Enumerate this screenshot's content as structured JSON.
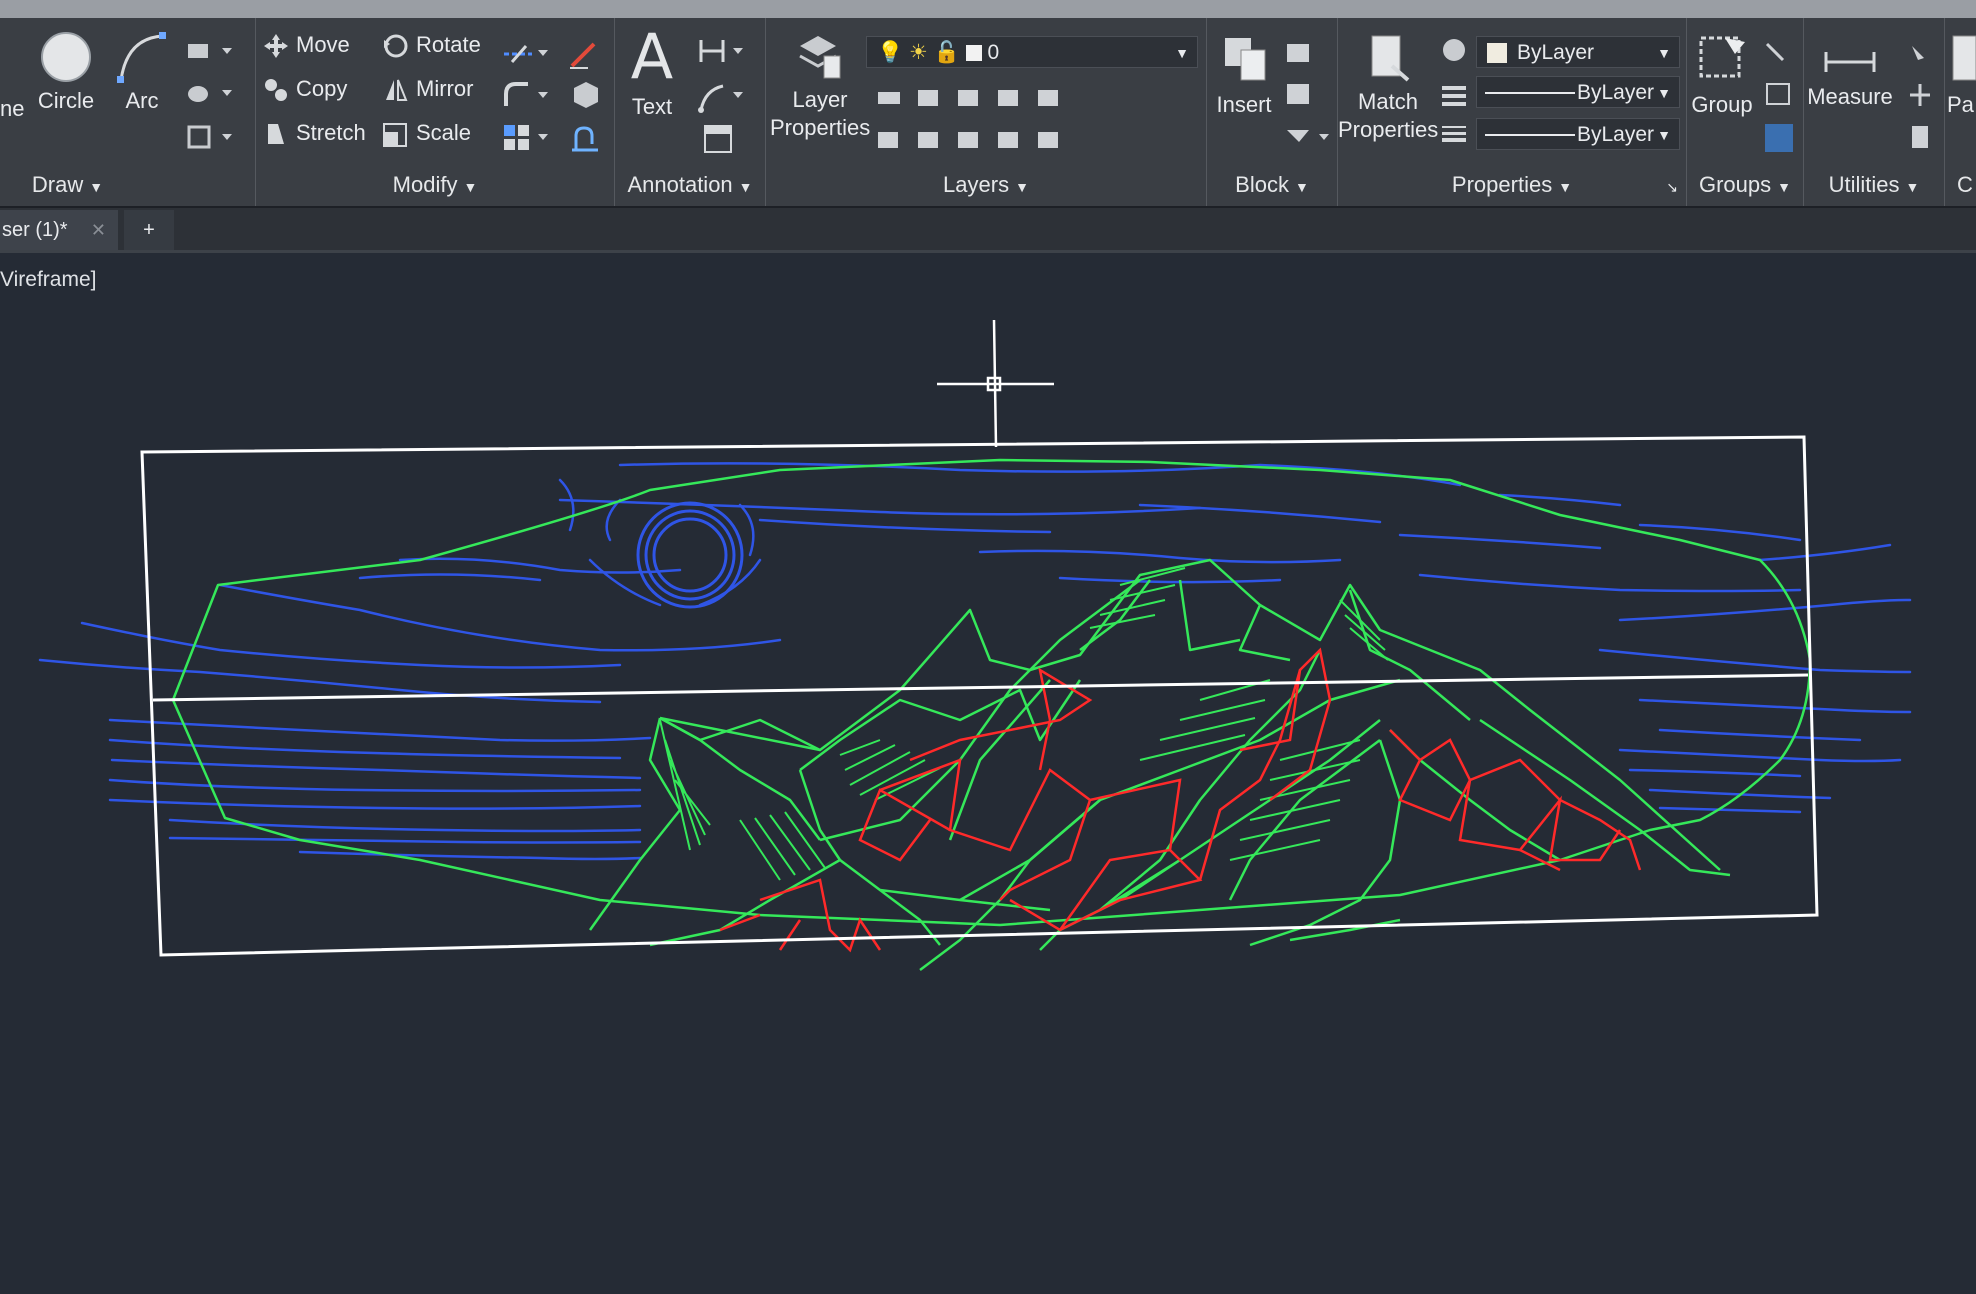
{
  "ribbon": {
    "draw": {
      "partial_label": "ne",
      "circle_label": "Circle",
      "arc_label": "Arc",
      "title": "Draw"
    },
    "modify": {
      "move": "Move",
      "rotate": "Rotate",
      "copy": "Copy",
      "mirror": "Mirror",
      "stretch": "Stretch",
      "scale": "Scale",
      "title": "Modify"
    },
    "annotation": {
      "text_label": "Text",
      "title": "Annotation"
    },
    "layers": {
      "layer_properties_line1": "Layer",
      "layer_properties_line2": "Properties",
      "current_layer": "0",
      "title": "Layers"
    },
    "block": {
      "insert_label": "Insert",
      "title": "Block"
    },
    "properties": {
      "match_line1": "Match",
      "match_line2": "Properties",
      "color_value": "ByLayer",
      "linetype_value": "ByLayer",
      "lineweight_value": "ByLayer",
      "title": "Properties"
    },
    "groups": {
      "group_label": "Group",
      "title": "Groups"
    },
    "utilities": {
      "measure_label": "Measure",
      "title": "Utilities"
    },
    "clipboard": {
      "partial_label": "Pa",
      "partial_title": "C"
    }
  },
  "tabs": {
    "document_tab": "ser (1)*",
    "close_glyph": "✕",
    "new_tab_glyph": "+"
  },
  "viewport": {
    "label": "Vireframe]"
  },
  "colors": {
    "background": "#252b35",
    "ribbon": "#3a3e44",
    "blue_layer": "#2f55e6",
    "green_layer": "#35e85a",
    "red_layer": "#ff2a2a",
    "boundary": "#ffffff"
  }
}
